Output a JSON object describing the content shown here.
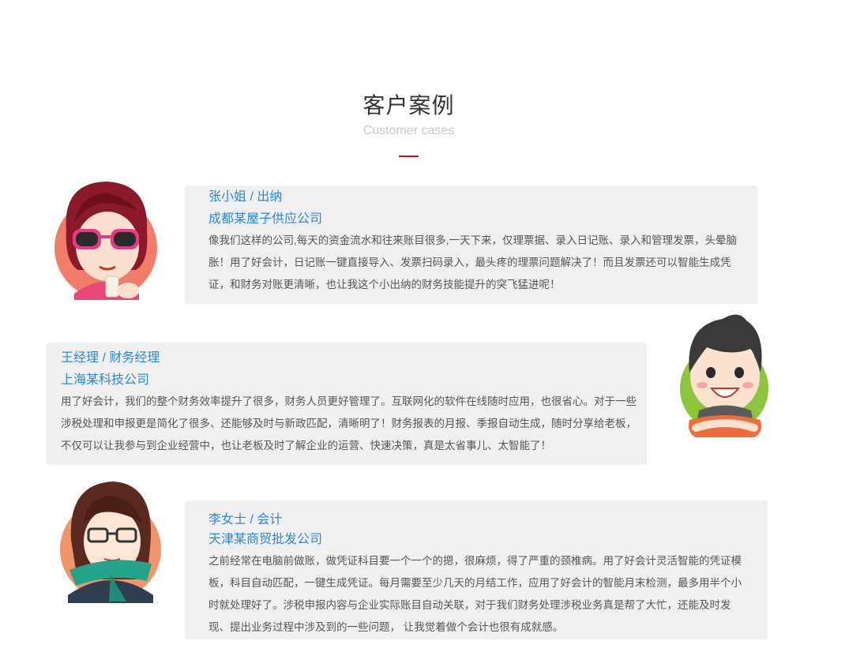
{
  "section": {
    "title": "客户案例",
    "subtitle": "Customer cases",
    "accent_color": "#b71c1c"
  },
  "cases": [
    {
      "name": "张小姐 / 出纳",
      "company": "成都某屋子供应公司",
      "text": "像我们这样的公司,每天的资金流水和往来账目很多,一天下来，仅理票据、录入日记账、录入和管理发票，头晕脑胀！用了好会计，日记账一键直接导入、发票扫码录入，最头疼的理票问题解决了！而且发票还可以智能生成凭证，和财务对账更清晰，也让我这个小出纳的财务技能提升的突飞猛进呢！",
      "avatar": "woman-sunglasses-avatar"
    },
    {
      "name": "王经理 / 财务经理",
      "company": "上海某科技公司",
      "text": "用了好会计，我们的整个财务效率提升了很多，财务人员更好管理了。互联网化的软件在线随时应用，也很省心。对于一些涉税处理和申报更是简化了很多、还能够及时与新政匹配，清晰明了！财务报表的月报、季报自动生成，随时分享给老板，不仅可以让我参与到企业经营中，也让老板及时了解企业的运营、快速决策，真是太省事儿、太智能了！",
      "avatar": "man-smiling-avatar"
    },
    {
      "name": "李女士 / 会计",
      "company": "天津某商贸批发公司",
      "text": "之前经常在电脑前做账，做凭证科目要一个一个的摁，很麻烦，得了严重的颈椎病。用了好会计灵活智能的凭证模板，科目自动匹配，一键生成凭证。每月需要至少几天的月结工作，应用了好会计的智能月末检测，最多用半个小时就处理好了。涉税申报内容与企业实际账目自动关联，对于我们财务处理涉税业务真是帮了大忙，还能及时发现、提出业务过程中涉及到的一些问题， 让我觉着做个会计也很有成就感。",
      "avatar": "woman-glasses-scarf-avatar"
    }
  ]
}
